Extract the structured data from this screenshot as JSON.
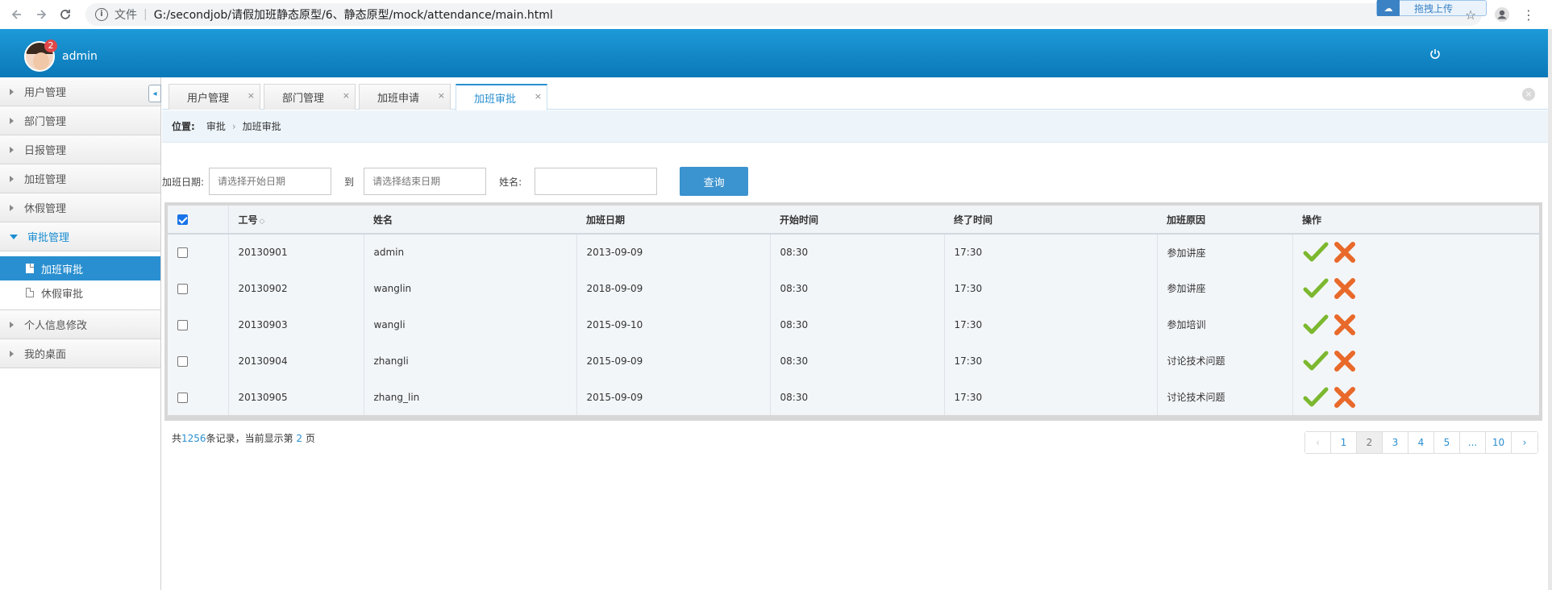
{
  "browser": {
    "file_label": "文件",
    "separator": "|",
    "url": "G:/secondjob/请假加班静态原型/6、静态原型/mock/attendance/main.html",
    "upload_label": "拖拽上传"
  },
  "header": {
    "user_name": "admin",
    "notification_count": "2"
  },
  "sidebar": {
    "items": [
      {
        "label": "用户管理"
      },
      {
        "label": "部门管理"
      },
      {
        "label": "日报管理"
      },
      {
        "label": "加班管理"
      },
      {
        "label": "休假管理"
      },
      {
        "label": "审批管理"
      }
    ],
    "sub_items": [
      {
        "label": "加班审批"
      },
      {
        "label": "休假审批"
      }
    ],
    "bottom_items": [
      {
        "label": "个人信息修改"
      },
      {
        "label": "我的桌面"
      }
    ],
    "collapse_glyph": "◂"
  },
  "tabs": [
    {
      "label": "用户管理"
    },
    {
      "label": "部门管理"
    },
    {
      "label": "加班申请"
    },
    {
      "label": "加班审批"
    }
  ],
  "tab_close_glyph": "×",
  "breadcrumb": {
    "position_label": "位置:",
    "items": [
      "审批",
      "加班审批"
    ],
    "separator": "›"
  },
  "filter": {
    "date_label": "加班日期:",
    "start_placeholder": "请选择开始日期",
    "to_label": "到",
    "end_placeholder": "请选择结束日期",
    "name_label": "姓名:",
    "name_value": "",
    "query_label": "查询"
  },
  "table": {
    "headers": [
      "工号",
      "姓名",
      "加班日期",
      "开始时间",
      "终了时间",
      "加班原因",
      "操作"
    ],
    "sort_glyph": "◇",
    "rows": [
      {
        "id": "20130901",
        "name": "admin",
        "date": "2013-09-09",
        "start": "08:30",
        "end": "17:30",
        "reason": "参加讲座"
      },
      {
        "id": "20130902",
        "name": "wanglin",
        "date": "2018-09-09",
        "start": "08:30",
        "end": "17:30",
        "reason": "参加讲座"
      },
      {
        "id": "20130903",
        "name": "wangli",
        "date": "2015-09-10",
        "start": "08:30",
        "end": "17:30",
        "reason": "参加培训"
      },
      {
        "id": "20130904",
        "name": "zhangli",
        "date": "2015-09-09",
        "start": "08:30",
        "end": "17:30",
        "reason": "讨论技术问题"
      },
      {
        "id": "20130905",
        "name": "zhang_lin",
        "date": "2015-09-09",
        "start": "08:30",
        "end": "17:30",
        "reason": "讨论技术问题"
      }
    ]
  },
  "footer": {
    "prefix": "共",
    "total": "1256",
    "middle": "条记录，当前显示第",
    "page": "2",
    "suffix": "页"
  },
  "pagination": {
    "prev": "‹",
    "pages": [
      "1",
      "2",
      "3",
      "4",
      "5",
      "...",
      "10"
    ],
    "next": "›",
    "current": "2"
  },
  "colors": {
    "header_blue": "#1b8ed1",
    "accent": "#2a8fd0",
    "approve_green": "#7cb82f",
    "reject_orange": "#e8692a"
  }
}
